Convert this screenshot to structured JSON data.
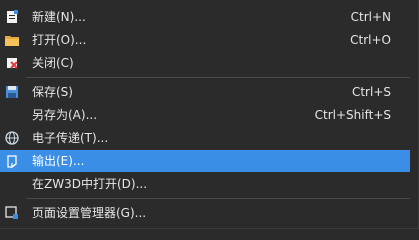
{
  "menu": {
    "items": [
      {
        "label": "新建(N)...",
        "shortcut": "Ctrl+N",
        "icon": "new-file-icon"
      },
      {
        "label": "打开(O)...",
        "shortcut": "Ctrl+O",
        "icon": "open-folder-icon"
      },
      {
        "label": "关闭(C)",
        "shortcut": "",
        "icon": "close-file-icon"
      },
      {
        "label": "保存(S)",
        "shortcut": "Ctrl+S",
        "icon": "save-icon"
      },
      {
        "label": "另存为(A)...",
        "shortcut": "Ctrl+Shift+S",
        "icon": ""
      },
      {
        "label": "电子传递(T)...",
        "shortcut": "",
        "icon": "globe-transmit-icon"
      },
      {
        "label": "输出(E)...",
        "shortcut": "",
        "icon": "export-icon",
        "highlighted": true
      },
      {
        "label": "在ZW3D中打开(D)...",
        "shortcut": "",
        "icon": ""
      },
      {
        "label": "页面设置管理器(G)...",
        "shortcut": "",
        "icon": "page-setup-icon"
      }
    ]
  },
  "colors": {
    "background": "#2b2b2b",
    "highlight": "#3a8ee6",
    "text": "#e6e6e6",
    "separator": "#4a4a4a"
  }
}
